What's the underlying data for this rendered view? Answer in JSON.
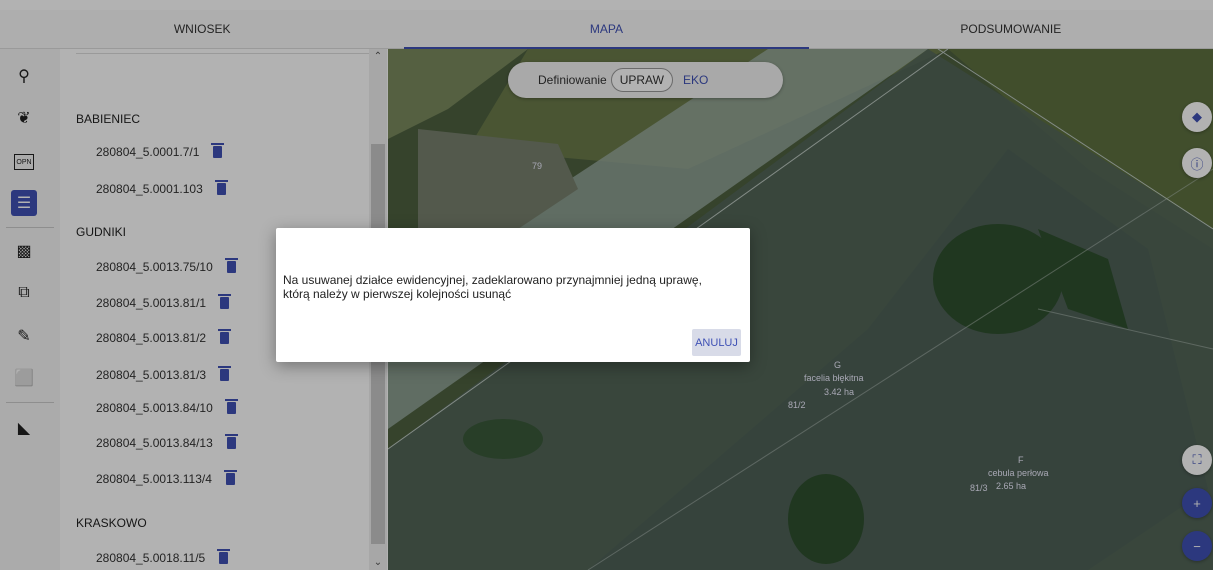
{
  "tabs": [
    "WNIOSEK",
    "MAPA",
    "PODSUMOWANIE"
  ],
  "active_tab": "MAPA",
  "toolbar": [
    {
      "icon": "search-icon",
      "glyph": "🔍"
    },
    {
      "icon": "crop-icon",
      "glyph": "❦"
    },
    {
      "icon": "opn-icon",
      "glyph": "OPN"
    },
    {
      "icon": "list-icon",
      "glyph": "☰"
    },
    {
      "icon": "select-area-icon",
      "glyph": "⬚"
    },
    {
      "icon": "copy-shape-icon",
      "glyph": "⧉"
    },
    {
      "icon": "edit-icon",
      "glyph": "✎"
    },
    {
      "icon": "draw-rect-icon",
      "glyph": "⬜"
    },
    {
      "icon": "measure-icon",
      "glyph": "◣"
    }
  ],
  "groups": [
    {
      "name": "BABIENIEC",
      "parcels": [
        "280804_5.0001.7/1",
        "280804_5.0001.103"
      ]
    },
    {
      "name": "GUDNIKI",
      "parcels": [
        "280804_5.0013.75/10",
        "280804_5.0013.81/1",
        "280804_5.0013.81/2",
        "280804_5.0013.81/3",
        "280804_5.0013.84/10",
        "280804_5.0013.84/13",
        "280804_5.0013.113/4"
      ]
    },
    {
      "name": "KRASKOWO",
      "parcels": [
        "280804_5.0018.11/5"
      ]
    }
  ],
  "mode": {
    "label": "Definiowanie",
    "option1": "UPRAW",
    "option2": "EKO"
  },
  "map_labels": {
    "p79": "79",
    "g_letter": "G",
    "g_crop": "facelia błękitna",
    "g_area": "3.42 ha",
    "p812": "81/2",
    "f_letter": "F",
    "f_crop": "cebula perłowa",
    "p813": "81/3",
    "f_area": "2.65 ha"
  },
  "dialog": {
    "message": "Na usuwanej działce ewidencyjnej, zadeklarowano przynajmniej jedną uprawę, którą należy w pierwszej kolejności usunąć",
    "cancel": "ANULUJ"
  },
  "colors": {
    "accent": "#3f51b5"
  }
}
